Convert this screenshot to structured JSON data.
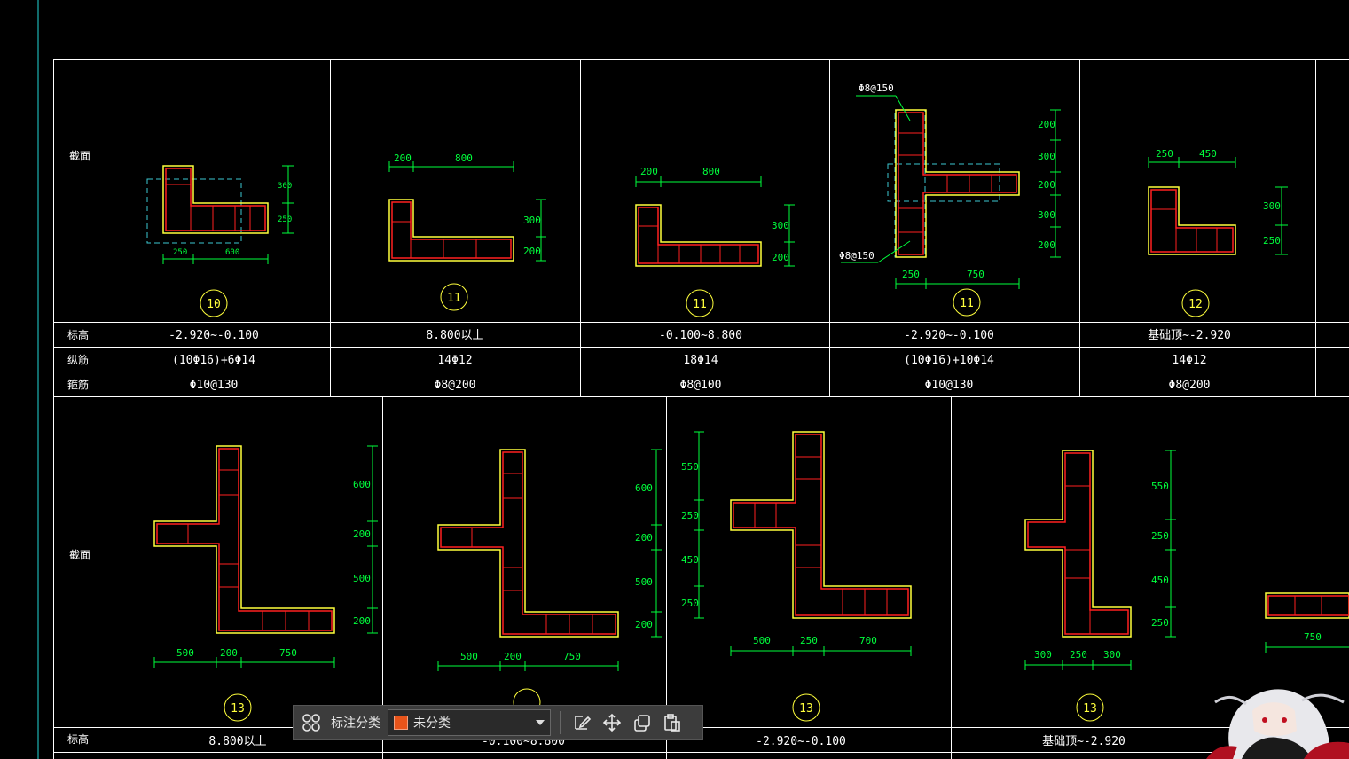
{
  "colors": {
    "frame": "#ffffff",
    "dim": "#00ff3c",
    "outline": "#ffff3c",
    "rebar": "#ff2020",
    "hatch": "#3cc8d2",
    "label": "#ffff3c"
  },
  "row1": {
    "header": {
      "section": "截面",
      "elevation": "标高",
      "longitudinal": "纵筋",
      "stirrup": "箍筋"
    },
    "cols": [
      {
        "id": "10",
        "elevation": "-2.920~-0.100",
        "long": "(10Φ16)+6Φ14",
        "stir": "Φ10@130",
        "dims": [
          "250",
          "600",
          "300",
          "250"
        ]
      },
      {
        "id": "11",
        "elevation": "8.800以上",
        "long": "14Φ12",
        "stir": "Φ8@200",
        "dims": [
          "200",
          "800",
          "300",
          "200"
        ]
      },
      {
        "id": "11",
        "elevation": "-0.100~8.800",
        "long": "18Φ14",
        "stir": "Φ8@100",
        "dims": [
          "200",
          "800",
          "300",
          "200"
        ]
      },
      {
        "id": "11",
        "elevation": "-2.920~-0.100",
        "long": "(10Φ16)+10Φ14",
        "stir": "Φ10@130",
        "dims": [
          "250",
          "750",
          "200",
          "300",
          "200",
          "300",
          "200"
        ],
        "notes": [
          "Φ8@150",
          "Φ8@150"
        ]
      },
      {
        "id": "12",
        "elevation": "基础顶~-2.920",
        "long": "14Φ12",
        "stir": "Φ8@200",
        "dims": [
          "250",
          "450",
          "300",
          "250"
        ]
      }
    ]
  },
  "row2": {
    "header": {
      "section": "截面",
      "elevation": "标高"
    },
    "cols": [
      {
        "id": "13",
        "elevation": "8.800以上",
        "dims": [
          "500",
          "200",
          "750",
          "600",
          "200",
          "500",
          "200"
        ]
      },
      {
        "id": "13",
        "elevation": "-0.100~8.800",
        "dims": [
          "500",
          "200",
          "750",
          "600",
          "200",
          "500",
          "200"
        ]
      },
      {
        "id": "13",
        "elevation": "-2.920~-0.100",
        "dims": [
          "500",
          "250",
          "700",
          "550",
          "250",
          "450",
          "250"
        ]
      },
      {
        "id": "13",
        "elevation": "基础顶~-2.920",
        "dims": [
          "300",
          "250",
          "300",
          "550",
          "250",
          "450",
          "250"
        ]
      },
      {
        "id": "",
        "elevation": "",
        "dims": [
          "750"
        ]
      }
    ]
  },
  "toolbar": {
    "category_label": "标注分类",
    "selected": "未分类",
    "icons": [
      "grid-icon",
      "edit-icon",
      "move-icon",
      "copy-icon",
      "paste-icon"
    ]
  }
}
